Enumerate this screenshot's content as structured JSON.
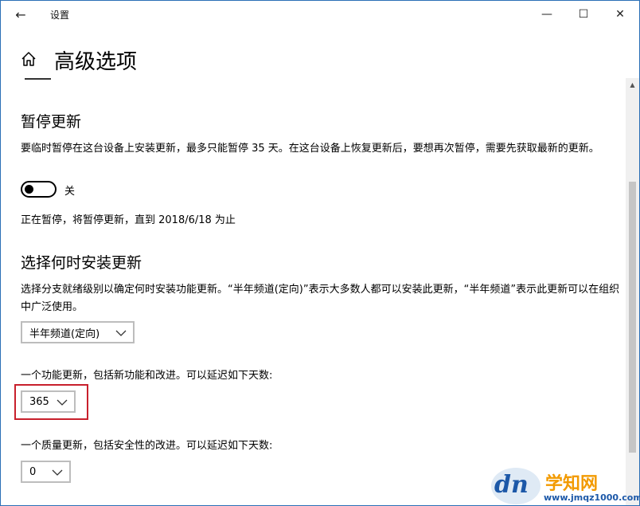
{
  "window": {
    "title": "设置",
    "back_glyph": "←",
    "minimize_glyph": "—",
    "maximize_glyph": "☐",
    "close_glyph": "✕"
  },
  "page": {
    "title": "高级选项"
  },
  "pause": {
    "heading": "暂停更新",
    "description": "要临时暂停在这台设备上安装更新，最多只能暂停 35 天。在这台设备上恢复更新后，要想再次暂停，需要先获取最新的更新。",
    "toggle_state": "off",
    "toggle_label": "关",
    "status": "正在暂停，将暂停更新，直到 2018/6/18 为止"
  },
  "install_timing": {
    "heading": "选择何时安装更新",
    "description": "选择分支就绪级别以确定何时安装功能更新。“半年频道(定向)”表示大多数人都可以安装此更新，“半年频道”表示此更新可以在组织中广泛使用。",
    "branch_select_value": "半年频道(定向)",
    "feature_label": "一个功能更新，包括新功能和改进。可以延迟如下天数:",
    "feature_defer_value": "365",
    "quality_label": "一个质量更新，包括安全性的改进。可以延迟如下天数:",
    "quality_defer_value": "0"
  },
  "colors": {
    "highlight": "#c8202c",
    "window_border": "#2b6fb6"
  },
  "watermark": {
    "logo_text": "dn",
    "name": "学知网",
    "url": "www.jmqz1000.com"
  }
}
